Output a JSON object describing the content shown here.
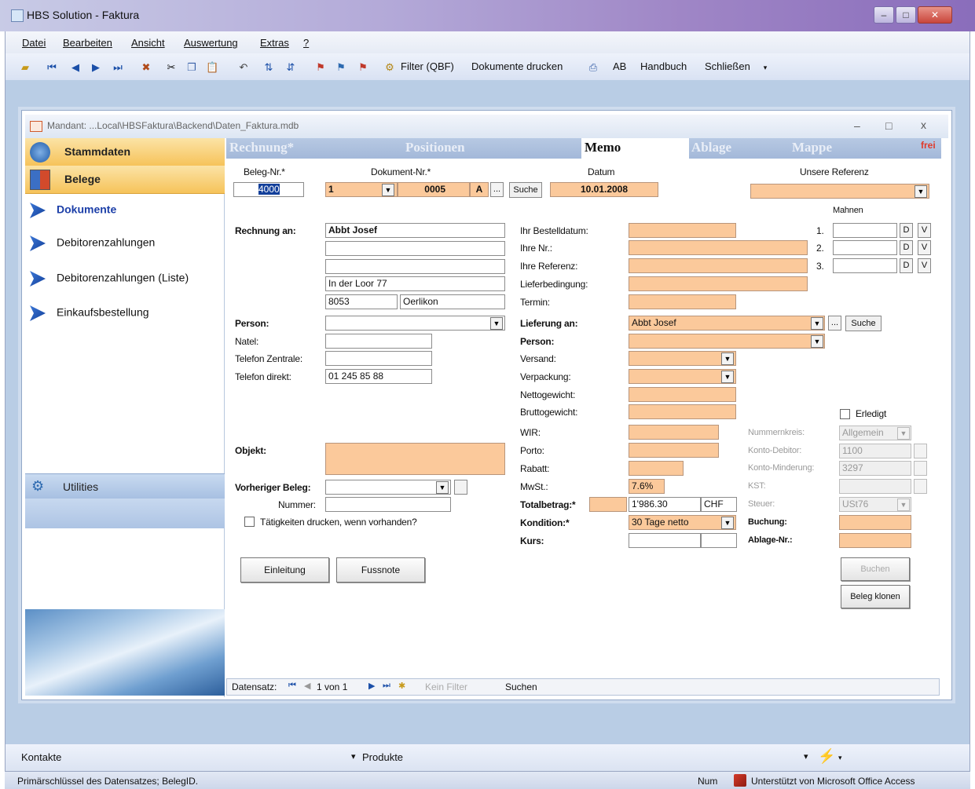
{
  "window": {
    "title": "HBS Solution - Faktura",
    "minimize": "–",
    "restore": "□",
    "close": "✕"
  },
  "menu": [
    "Datei",
    "Bearbeiten",
    "Ansicht",
    "Auswertung",
    "Extras",
    "?"
  ],
  "toolbar": {
    "filter": "Filter (QBF)",
    "print": "Dokumente drucken",
    "ab": "AB",
    "handbuch": "Handbuch",
    "close": "Schließen"
  },
  "form": {
    "title": "Mandant: ...Local\\HBSFaktura\\Backend\\Daten_Faktura.mdb",
    "min": "–",
    "max": "□",
    "close": "x"
  },
  "nav": {
    "stammdaten": "Stammdaten",
    "belege": "Belege",
    "items": [
      "Dokumente",
      "Debitorenzahlungen",
      "Debitorenzahlungen (Liste)",
      "Einkaufsbestellung"
    ],
    "utilities": "Utilities"
  },
  "tabs": [
    "Rechnung*",
    "Positionen",
    "Memo",
    "Ablage",
    "Mappe"
  ],
  "tab_flag": "frei",
  "header": {
    "beleg_label": "Beleg-Nr.*",
    "beleg_value": "4000",
    "dok_label": "Dokument-Nr.*",
    "dok_type": "1",
    "dok_number": "0005",
    "dok_suffix": "A",
    "dots": "...",
    "suche": "Suche",
    "datum_label": "Datum",
    "datum_value": "10.01.2008",
    "ref_label": "Unsere Referenz"
  },
  "left": {
    "rechnung_an": "Rechnung an:",
    "name": "Abbt Josef",
    "street": "In der Loor 77",
    "plz": "8053",
    "ort": "Oerlikon",
    "person": "Person:",
    "natel": "Natel:",
    "tel_zentrale": "Telefon Zentrale:",
    "tel_direkt": "Telefon direkt:",
    "tel_direkt_value": "01 245 85 88",
    "objekt": "Objekt:",
    "vorheriger_beleg": "Vorheriger Beleg:",
    "nummer": "Nummer:",
    "taetigkeiten": "Tätigkeiten drucken, wenn vorhanden?",
    "einleitung": "Einleitung",
    "fussnote": "Fussnote"
  },
  "middle": {
    "bestelldatum": "Ihr Bestelldatum:",
    "ihre_nr": "Ihre Nr.:",
    "ihre_referenz": "Ihre Referenz:",
    "lieferbedingung": "Lieferbedingung:",
    "termin": "Termin:",
    "lieferung_an": "Lieferung an:",
    "lieferung_value": "Abbt Josef",
    "person": "Person:",
    "versand": "Versand:",
    "verpackung": "Verpackung:",
    "netto": "Nettogewicht:",
    "brutto": "Bruttogewicht:",
    "wir": "WIR:",
    "porto": "Porto:",
    "rabatt": "Rabatt:",
    "mwst": "MwSt.:",
    "mwst_value": "7.6%",
    "totalbetrag": "Totalbetrag:*",
    "total_value": "1'986.30",
    "currency": "CHF",
    "kondition": "Kondition:*",
    "kondition_value": "30 Tage netto",
    "kurs": "Kurs:"
  },
  "right": {
    "mahnen": "Mahnen",
    "levels": [
      "1.",
      "2.",
      "3."
    ],
    "d": "D",
    "v": "V",
    "erledigt": "Erledigt",
    "nummernkreis": "Nummernkreis:",
    "nummernkreis_value": "Allgemein",
    "konto_debitor": "Konto-Debitor:",
    "konto_debitor_value": "1100",
    "konto_minderung": "Konto-Minderung:",
    "konto_minderung_value": "3297",
    "kst": "KST:",
    "steuer": "Steuer:",
    "steuer_value": "USt76",
    "buchung": "Buchung:",
    "ablage_nr": "Ablage-Nr.:",
    "buchen": "Buchen",
    "beleg_klonen": "Beleg klonen"
  },
  "recordnav": {
    "label": "Datensatz:",
    "position": "1 von 1",
    "filter": "Kein Filter",
    "search": "Suchen"
  },
  "bottom": {
    "kontakte": "Kontakte",
    "produkte": "Produkte"
  },
  "status": {
    "text": "Primärschlüssel des Datensatzes; BelegID.",
    "num": "Num",
    "office": "Unterstützt von Microsoft Office Access"
  }
}
